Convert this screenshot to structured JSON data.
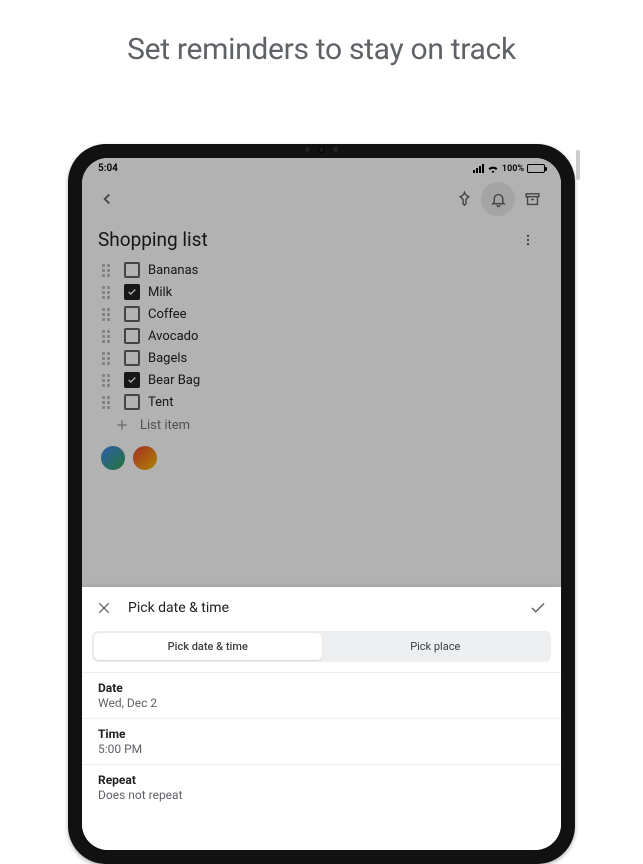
{
  "promo_title": "Set reminders to stay on track",
  "status": {
    "time": "5:04",
    "wifi_label": "100%"
  },
  "note": {
    "title": "Shopping list",
    "items": [
      {
        "label": "Bananas",
        "checked": false
      },
      {
        "label": "Milk",
        "checked": true
      },
      {
        "label": "Coffee",
        "checked": false
      },
      {
        "label": "Avocado",
        "checked": false
      },
      {
        "label": "Bagels",
        "checked": false
      },
      {
        "label": "Bear Bag",
        "checked": true
      },
      {
        "label": "Tent",
        "checked": false
      }
    ],
    "add_placeholder": "List item"
  },
  "sheet": {
    "title": "Pick date & time",
    "tabs": {
      "date_time": "Pick date & time",
      "place": "Pick place"
    },
    "fields": {
      "date": {
        "label": "Date",
        "value": "Wed, Dec 2"
      },
      "time": {
        "label": "Time",
        "value": "5:00 PM"
      },
      "repeat": {
        "label": "Repeat",
        "value": "Does not repeat"
      }
    }
  }
}
